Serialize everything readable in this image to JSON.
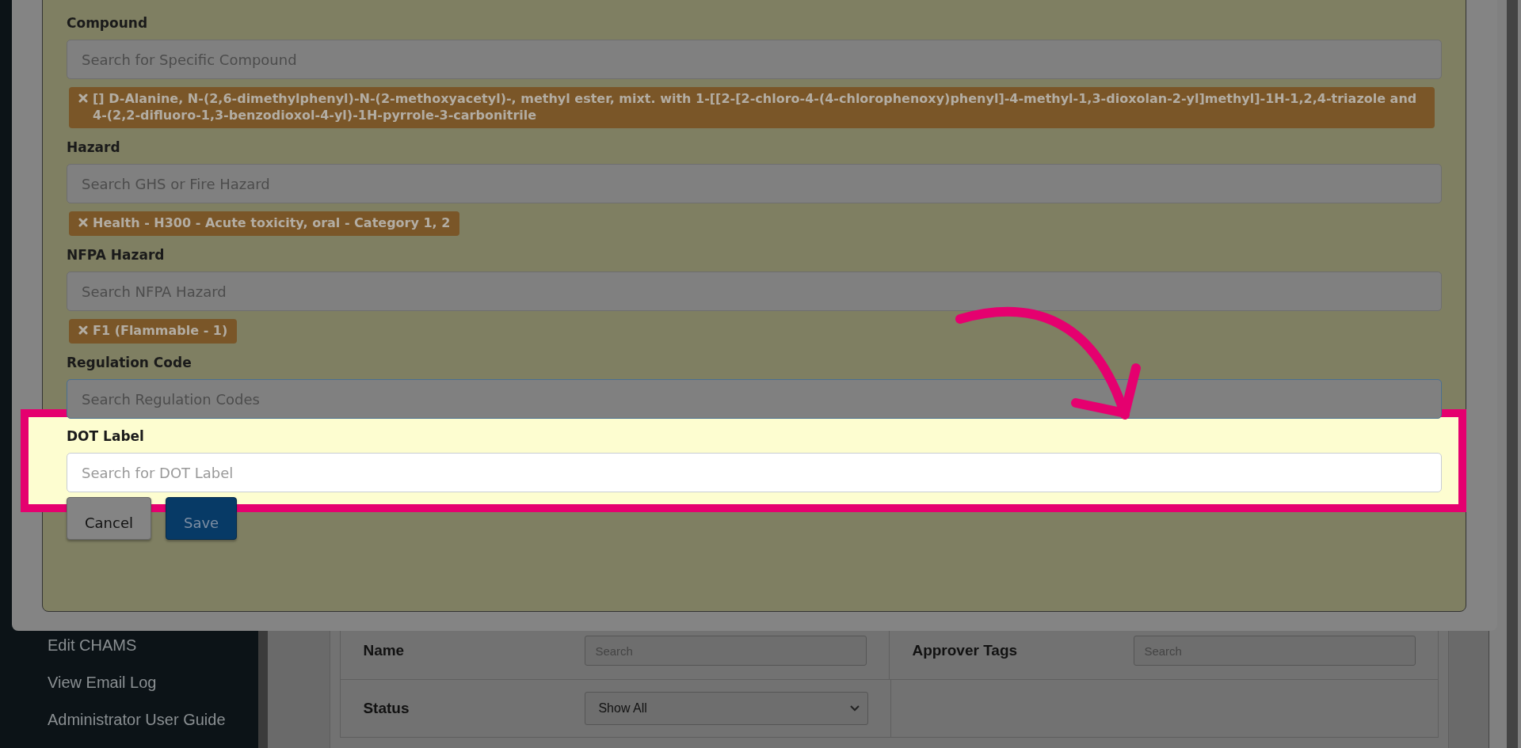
{
  "sidebar": {
    "items": [
      {
        "label": "Edit CHAMS"
      },
      {
        "label": "View Email Log"
      },
      {
        "label": "Administrator User Guide"
      }
    ]
  },
  "filters": {
    "rows": [
      {
        "cells": [
          {
            "label": "Name",
            "kind": "search",
            "value": "Search"
          },
          {
            "label": "Approver Tags",
            "kind": "search",
            "value": "Search"
          }
        ]
      },
      {
        "cells": [
          {
            "label": "Status",
            "kind": "select",
            "value": "Show All"
          }
        ]
      }
    ]
  },
  "dialog": {
    "fields": [
      {
        "label": "Compound",
        "placeholder": "Search for Specific Compound",
        "focused": false,
        "tags": [
          "[] D-Alanine, N-(2,6-dimethylphenyl)-N-(2-methoxyacetyl)-, methyl ester, mixt. with 1-[[2-[2-chloro-4-(4-chlorophenoxy)phenyl]-4-methyl-1,3-dioxolan-2-yl]methyl]-1H-1,2,4-triazole and 4-(2,2-difluoro-1,3-benzodioxol-4-yl)-1H-pyrrole-3-carbonitrile"
        ]
      },
      {
        "label": "Hazard",
        "placeholder": "Search GHS or Fire Hazard",
        "focused": false,
        "tags": [
          "Health - H300 - Acute toxicity, oral - Category 1, 2"
        ]
      },
      {
        "label": "NFPA Hazard",
        "placeholder": "Search NFPA Hazard",
        "focused": false,
        "tags": [
          "F1 (Flammable - 1)"
        ]
      },
      {
        "label": "Regulation Code",
        "placeholder": "Search Regulation Codes",
        "focused": true
      },
      {
        "label": "DOT Label",
        "placeholder": "Search for DOT Label",
        "focused": false
      }
    ],
    "buttons": [
      {
        "label": "Cancel",
        "kind": "secondary"
      },
      {
        "label": "Save",
        "kind": "primary"
      }
    ]
  }
}
